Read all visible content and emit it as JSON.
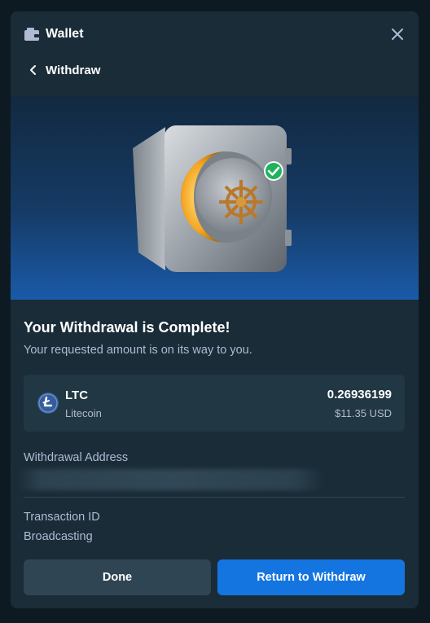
{
  "header": {
    "title": "Wallet",
    "wallet_icon": "wallet-icon",
    "close_icon": "close-icon"
  },
  "nav": {
    "back_label": "Withdraw",
    "back_icon": "chevron-left-icon"
  },
  "banner": {
    "image": "vault-with-checkmark-illustration"
  },
  "status": {
    "title": "Your Withdrawal is Complete!",
    "subtitle": "Your requested amount is on its way to you."
  },
  "coin": {
    "symbol": "LTC",
    "name": "Litecoin",
    "amount": "0.26936199",
    "usd_value": "$11.35 USD",
    "icon": "litecoin-icon",
    "icon_color": "#345d9d"
  },
  "details": {
    "address_label": "Withdrawal Address",
    "tx_label": "Transaction ID",
    "tx_value": "Broadcasting"
  },
  "buttons": {
    "done_label": "Done",
    "return_label": "Return to Withdraw"
  },
  "colors": {
    "modal_bg": "#1a2c38",
    "card_bg": "#213743",
    "primary": "#1475e1",
    "secondary": "#2f4553",
    "muted_text": "#b1bad3"
  }
}
